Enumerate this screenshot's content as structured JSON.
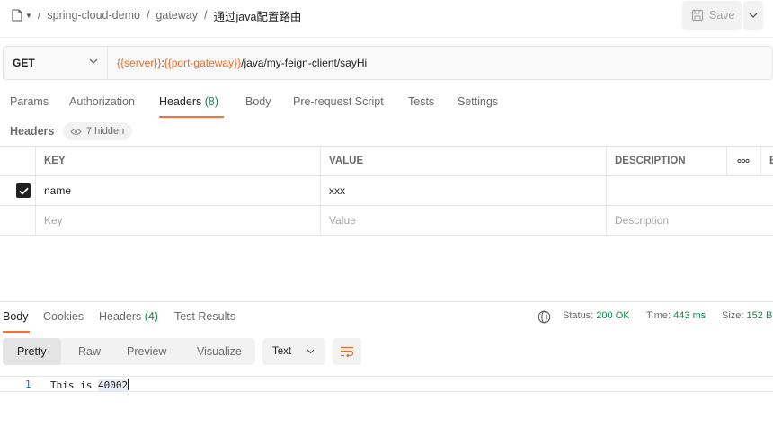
{
  "breadcrumb": {
    "icon": "document-icon",
    "items": [
      "spring-cloud-demo",
      "gateway"
    ],
    "separator": "/",
    "current": "通过java配置路由"
  },
  "toolbar": {
    "save_label": "Save",
    "save_icon": "save-icon",
    "more_icon": "chevron-down-icon"
  },
  "request": {
    "method": "GET",
    "url_parts": {
      "server_var": "{{server}}",
      "colon": ":",
      "port_var": "{{port-gateway}}",
      "path": "/java/my-feign-client/sayHi"
    }
  },
  "request_tabs": [
    {
      "label": "Params"
    },
    {
      "label": "Authorization"
    },
    {
      "label": "Headers",
      "count": "(8)",
      "active": true
    },
    {
      "label": "Body"
    },
    {
      "label": "Pre-request Script"
    },
    {
      "label": "Tests"
    },
    {
      "label": "Settings"
    }
  ],
  "headers_section": {
    "title": "Headers",
    "hidden_label": "7 hidden",
    "hidden_icon": "eye-icon"
  },
  "headers_table": {
    "columns": [
      "KEY",
      "VALUE",
      "DESCRIPTION"
    ],
    "more_icon": "more-horizontal-icon",
    "overflow_label": "B",
    "rows": [
      {
        "checked": true,
        "key": "name",
        "value": "xxx",
        "description": ""
      }
    ],
    "placeholders": {
      "key": "Key",
      "value": "Value",
      "description": "Description"
    }
  },
  "response": {
    "tabs": [
      {
        "label": "Body",
        "active": true
      },
      {
        "label": "Cookies"
      },
      {
        "label": "Headers",
        "count": "(4)"
      },
      {
        "label": "Test Results"
      }
    ],
    "globe_icon": "globe-icon",
    "status_label": "Status:",
    "status_value": "200 OK",
    "time_label": "Time:",
    "time_value": "443 ms",
    "size_label": "Size:",
    "size_value": "152 B",
    "views": [
      "Pretty",
      "Raw",
      "Preview",
      "Visualize"
    ],
    "active_view": "Pretty",
    "format": "Text",
    "wrap_icon": "wrap-lines-icon",
    "lines": [
      {
        "number": "1",
        "text_plain": "This is ",
        "text_highlight": "40002"
      }
    ]
  },
  "colors": {
    "accent": "#ff6c37",
    "variable": "#e06f2c",
    "success": "#0f8a4f",
    "line_number": "#0b6fcf"
  }
}
